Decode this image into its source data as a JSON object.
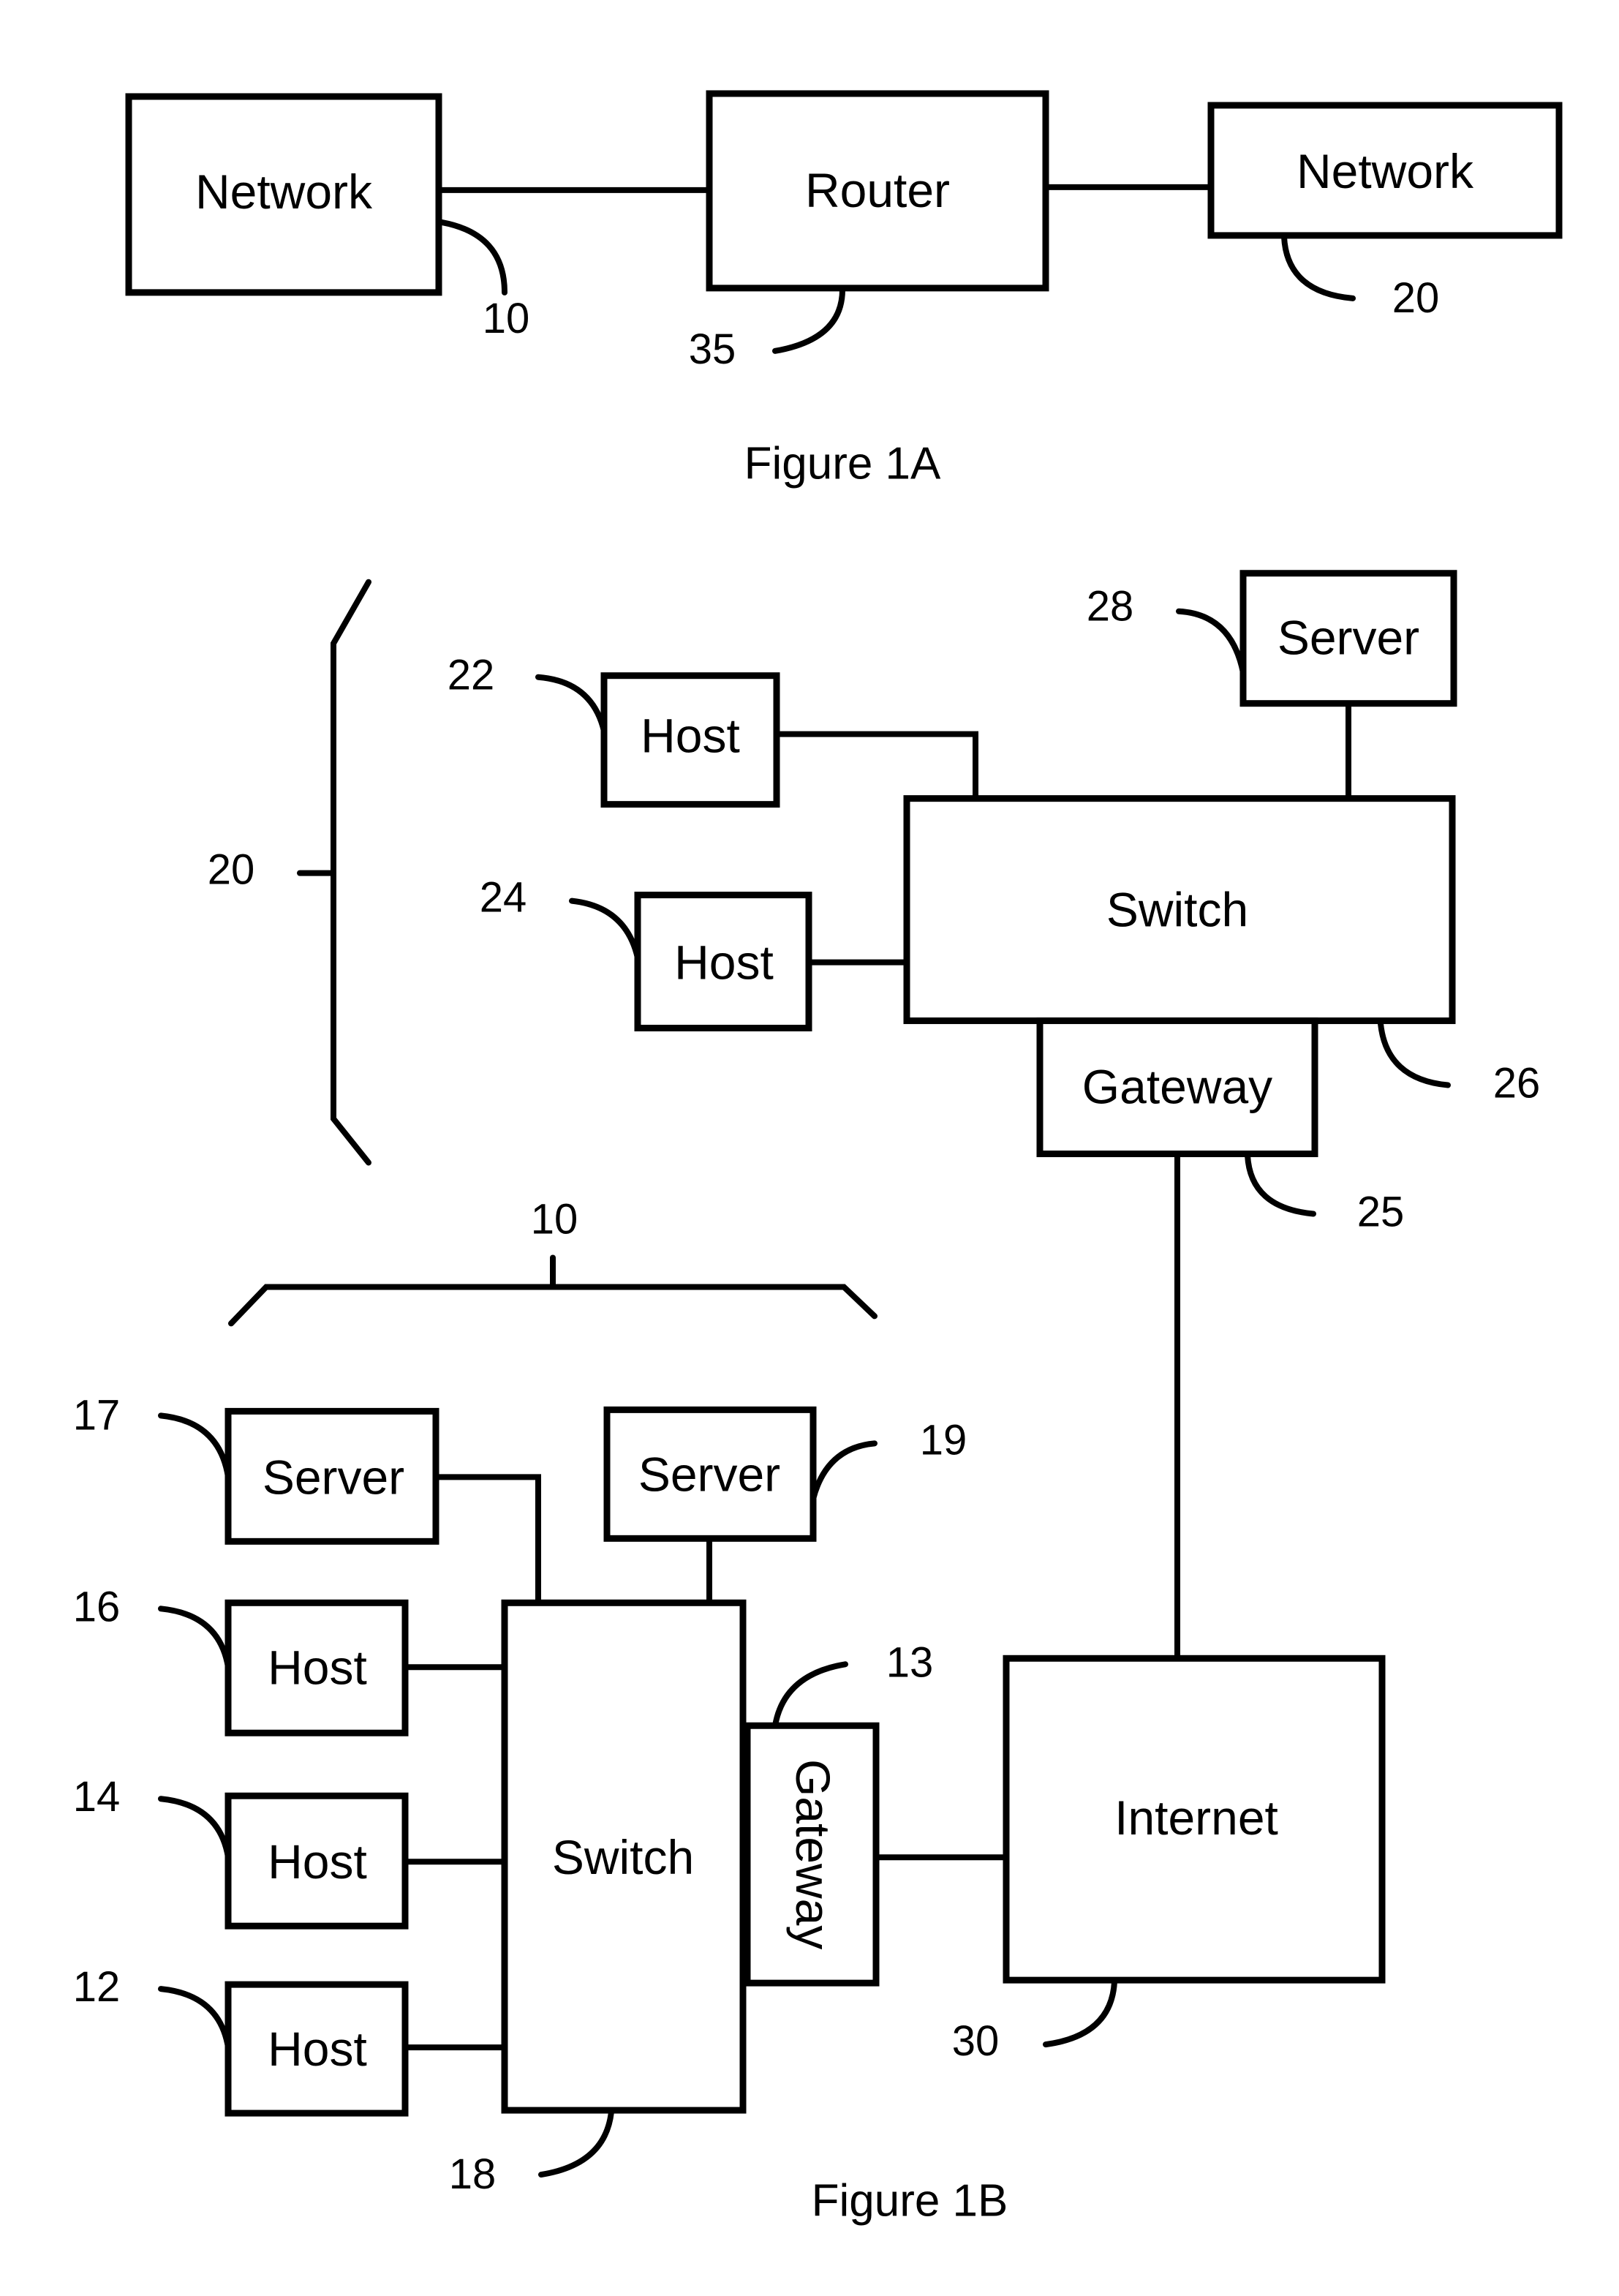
{
  "figure_1a": {
    "caption": "Figure 1A",
    "nodes": {
      "network_left": {
        "label": "Network",
        "ref": "10"
      },
      "router": {
        "label": "Router",
        "ref": "35"
      },
      "network_right": {
        "label": "Network",
        "ref": "20"
      }
    },
    "connections": [
      [
        "network_left",
        "router"
      ],
      [
        "router",
        "network_right"
      ]
    ]
  },
  "figure_1b": {
    "caption": "Figure 1B",
    "network_20": {
      "brace_ref": "20",
      "host_22": {
        "label": "Host",
        "ref": "22"
      },
      "host_24": {
        "label": "Host",
        "ref": "24"
      },
      "server_28": {
        "label": "Server",
        "ref": "28"
      },
      "switch_26": {
        "label": "Switch",
        "ref": "26"
      },
      "gateway_25": {
        "label": "Gateway",
        "ref": "25"
      }
    },
    "network_10": {
      "brace_ref": "10",
      "server_17": {
        "label": "Server",
        "ref": "17"
      },
      "server_19": {
        "label": "Server",
        "ref": "19"
      },
      "host_16": {
        "label": "Host",
        "ref": "16"
      },
      "host_14": {
        "label": "Host",
        "ref": "14"
      },
      "host_12": {
        "label": "Host",
        "ref": "12"
      },
      "switch_18": {
        "label": "Switch",
        "ref": "18"
      },
      "gateway_13": {
        "label": "Gateway",
        "ref": "13"
      }
    },
    "internet_30": {
      "label": "Internet",
      "ref": "30"
    }
  }
}
